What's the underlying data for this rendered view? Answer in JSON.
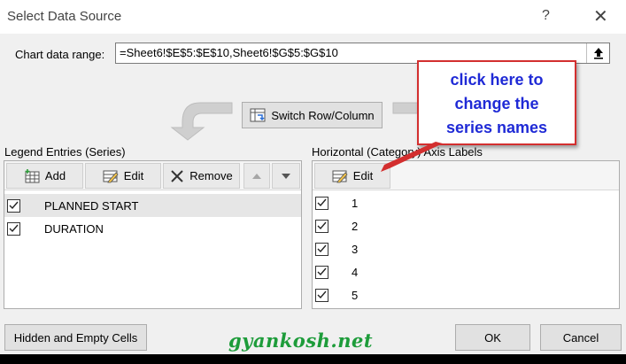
{
  "window": {
    "title": "Select Data Source",
    "help_label": "?",
    "close_label": "✕"
  },
  "range": {
    "label": "Chart data range:",
    "value": "=Sheet6!$E$5:$E$10,Sheet6!$G$5:$G$10"
  },
  "switch_button": {
    "label": "Switch Row/Column"
  },
  "legend": {
    "title": "Legend Entries (Series)",
    "add_label": "Add",
    "edit_label": "Edit",
    "remove_label": "Remove",
    "series": [
      {
        "name": "PLANNED START",
        "checked": true
      },
      {
        "name": "DURATION",
        "checked": true
      }
    ]
  },
  "axis": {
    "title": "Horizontal (Category) Axis Labels",
    "edit_label": "Edit",
    "labels": [
      "1",
      "2",
      "3",
      "4",
      "5"
    ]
  },
  "footer": {
    "hidden_cells_label": "Hidden and Empty Cells",
    "ok_label": "OK",
    "cancel_label": "Cancel"
  },
  "annotation": {
    "line1": "click here to",
    "line2": "change the",
    "line3": "series names",
    "text_color": "#1f2ad6",
    "border_color": "#d32f2f"
  },
  "watermark": {
    "text": "gyankosh.net",
    "color": "#1d9c3a"
  }
}
